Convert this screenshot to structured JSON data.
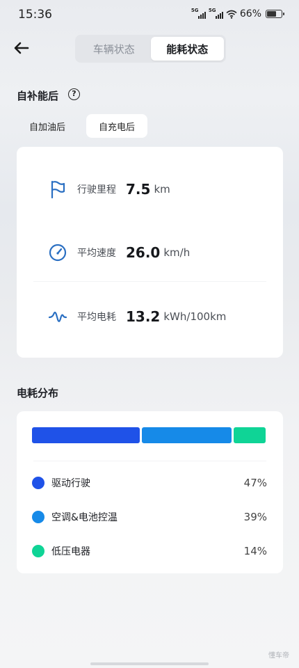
{
  "status_bar": {
    "time": "15:36",
    "net1": "5G",
    "net2": "5G",
    "battery": "66%",
    "battery_level": 0.66
  },
  "tabs": [
    {
      "label": "车辆状态",
      "active": false
    },
    {
      "label": "能耗状态",
      "active": true
    }
  ],
  "since_refuel": {
    "title": "自补能后",
    "help_icon": "?",
    "sub_tabs": [
      {
        "label": "自加油后",
        "active": false
      },
      {
        "label": "自充电后",
        "active": true
      }
    ],
    "stats": [
      {
        "icon": "flag-icon",
        "label": "行驶里程",
        "value": "7.5",
        "unit": "km"
      },
      {
        "icon": "speedometer-icon",
        "label": "平均速度",
        "value": "26.0",
        "unit": "km/h"
      },
      {
        "icon": "energy-wave-icon",
        "label": "平均电耗",
        "value": "13.2",
        "unit": "kWh/100km"
      }
    ]
  },
  "distribution": {
    "title": "电耗分布",
    "items": [
      {
        "label": "驱动行驶",
        "percent": "47%",
        "share": 0.47,
        "color": "#1f52e8"
      },
      {
        "label": "空调&电池控温",
        "percent": "39%",
        "share": 0.39,
        "color": "#168ae8"
      },
      {
        "label": "低压电器",
        "percent": "14%",
        "share": 0.14,
        "color": "#0fd496"
      }
    ]
  },
  "colors": {
    "icon_blue": "#2a6fc2",
    "accent": "#1f52e8"
  },
  "watermark": "懂车帝"
}
